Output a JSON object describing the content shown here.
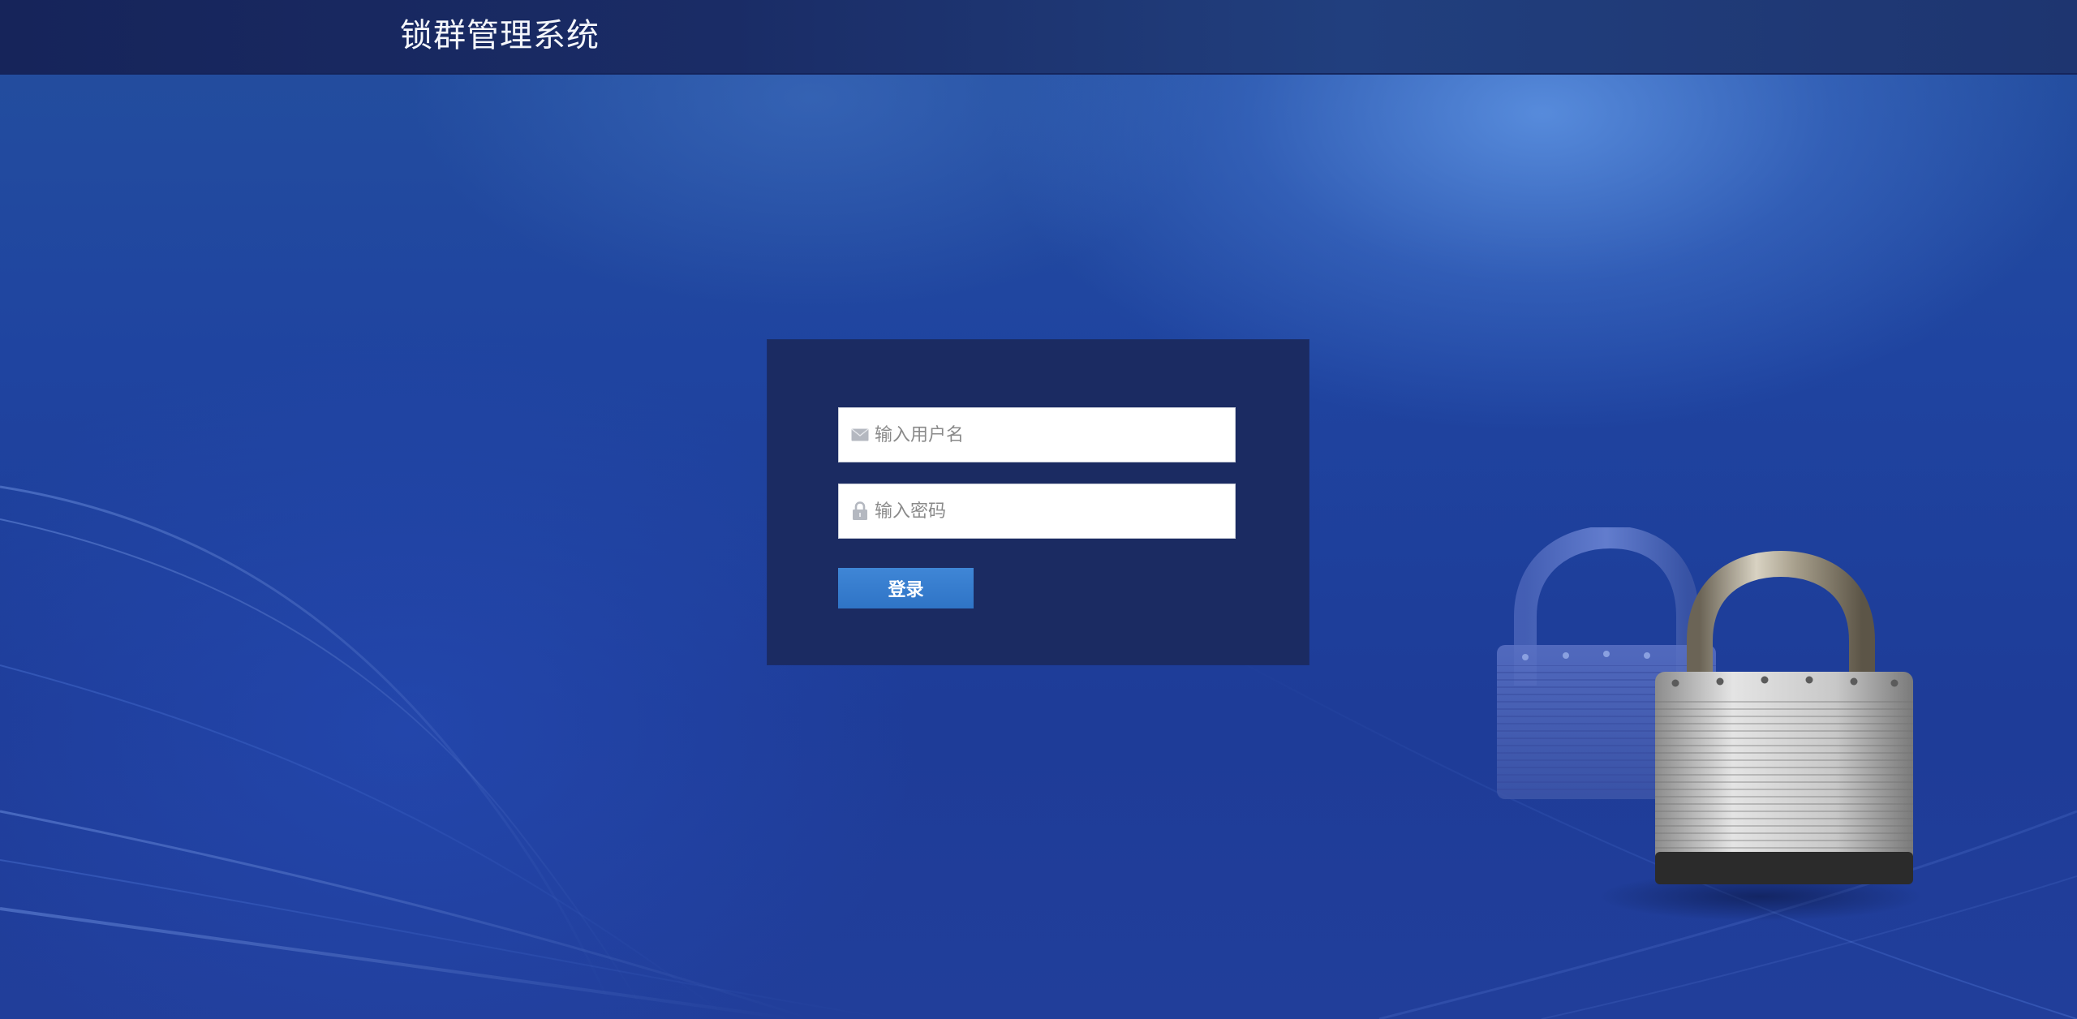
{
  "header": {
    "title": "锁群管理系统"
  },
  "login": {
    "username_placeholder": "输入用户名",
    "username_value": "",
    "password_placeholder": "输入密码",
    "password_value": "",
    "submit_label": "登录",
    "username_icon": "envelope-icon",
    "password_icon": "lock-icon"
  },
  "colors": {
    "header_bg": "#1a2c66",
    "page_bg": "#1e3c98",
    "panel_bg": "#1b2b62",
    "button_bg": "#3a7fd0",
    "title_text": "#f4f6fb"
  },
  "decorations": {
    "illustration": "padlocks-illustration"
  }
}
